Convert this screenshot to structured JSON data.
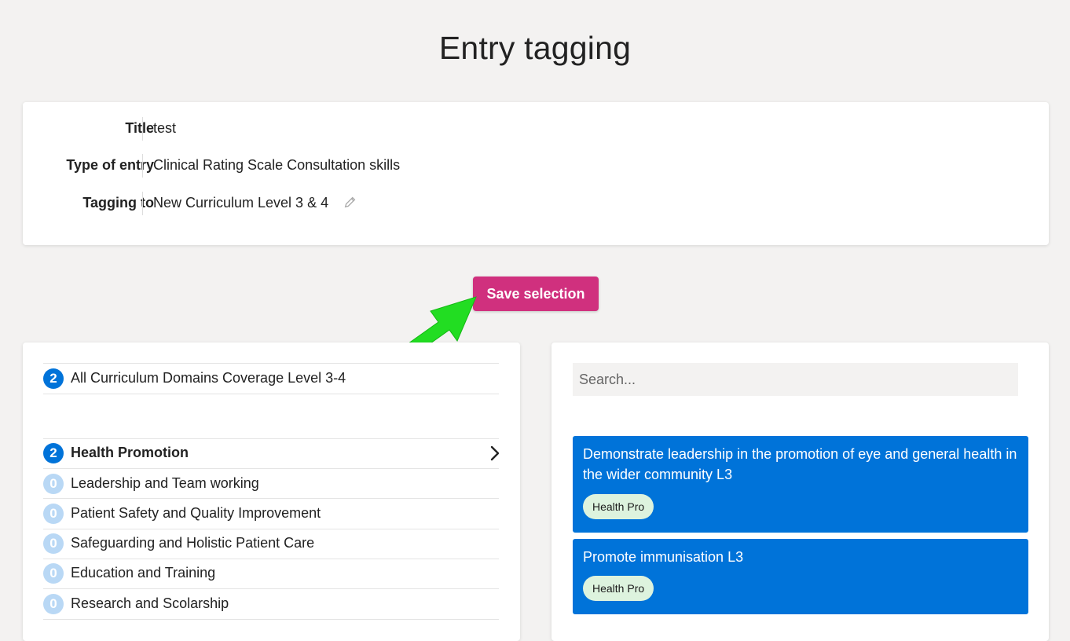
{
  "page": {
    "title": "Entry tagging"
  },
  "info": {
    "rows": [
      {
        "label": "Title",
        "value": "test"
      },
      {
        "label": "Type of entry",
        "value": "Clinical Rating Scale Consultation skills"
      },
      {
        "label": "Tagging to",
        "value": "New Curriculum Level 3 & 4"
      }
    ]
  },
  "actions": {
    "save_label": "Save selection"
  },
  "curriculum": {
    "overall": {
      "count": "2",
      "label": "All Curriculum Domains Coverage Level 3-4"
    },
    "domains": [
      {
        "count": "2",
        "label": "Health Promotion"
      },
      {
        "count": "0",
        "label": "Leadership and Team working"
      },
      {
        "count": "0",
        "label": "Patient Safety and Quality Improvement"
      },
      {
        "count": "0",
        "label": "Safeguarding and Holistic Patient Care"
      },
      {
        "count": "0",
        "label": "Education and Training"
      },
      {
        "count": "0",
        "label": "Research and Scolarship"
      }
    ]
  },
  "search": {
    "placeholder": "Search...",
    "value": ""
  },
  "outcomes": [
    {
      "title": "Demonstrate leadership in the promotion of eye and general health in the wider community L3",
      "tag": "Health Pro"
    },
    {
      "title": "Promote immunisation L3",
      "tag": "Health Pro"
    }
  ],
  "colors": {
    "accent": "#d0307e",
    "primary_blue": "#0073d9",
    "badge_zero": "#b9d8f5",
    "tag_bg": "#ddf3de",
    "annotation_arrow": "#22dd22"
  },
  "icons": {
    "edit": "pencil-icon",
    "expand": "chevron-right-icon",
    "annotation": "green-arrow-icon"
  }
}
